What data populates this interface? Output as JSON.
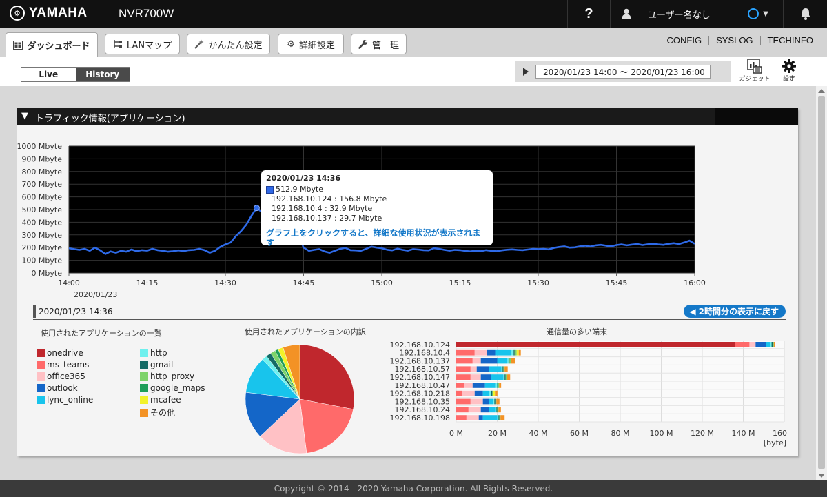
{
  "header": {
    "brand": "YAMAHA",
    "model": "NVR700W",
    "help_label": "?",
    "user_label": "ユーザー名なし"
  },
  "tabs": [
    {
      "label": "ダッシュボード",
      "icon": "dashboard-icon",
      "active": true
    },
    {
      "label": "LANマップ",
      "icon": "lan-map-icon",
      "active": false
    },
    {
      "label": "かんたん設定",
      "icon": "wand-icon",
      "active": false
    },
    {
      "label": "詳細設定",
      "icon": "gear-icon",
      "active": false
    },
    {
      "label": "管　理",
      "icon": "wrench-icon",
      "active": false
    }
  ],
  "top_links": [
    "CONFIG",
    "SYSLOG",
    "TECHINFO"
  ],
  "mode": {
    "live_label": "Live",
    "history_label": "History",
    "selected": "History"
  },
  "range_text": "2020/01/23 14:00 〜 2020/01/23 16:00",
  "tools": {
    "gadget_label": "ガジェット",
    "settings_label": "設定"
  },
  "panel": {
    "title": "トラフィック情報(アプリケーション)"
  },
  "tooltip": {
    "title": "2020/01/23 14:36",
    "total": "512.9 Mbyte",
    "rows": [
      "192.168.10.124 : 156.8 Mbyte",
      "192.168.10.4 : 32.9 Mbyte",
      "192.168.10.137 : 29.7 Mbyte"
    ],
    "hint": "グラフ上をクリックすると、詳細な使用状況が表示されます"
  },
  "detail": {
    "date": "2020/01/23 14:36",
    "back_label": "2時間分の表示に戻す"
  },
  "sections": {
    "apps_title": "使用されたアプリケーションの一覧",
    "pie_title": "使用されたアプリケーションの内訳",
    "hosts_title": "通信量の多い端末"
  },
  "colors": {
    "accent": "#1478c8",
    "line": "#2e6ae8"
  },
  "chart_data": [
    {
      "type": "line",
      "title": "",
      "x_labels": [
        "14:00",
        "14:15",
        "14:30",
        "14:45",
        "15:00",
        "15:15",
        "15:30",
        "15:45",
        "16:00"
      ],
      "x_sublabel": "2020/01/23",
      "y_ticks": [
        "0 Mbyte",
        "100 Mbyte",
        "200 Mbyte",
        "300 Mbyte",
        "400 Mbyte",
        "500 Mbyte",
        "600 Mbyte",
        "700 Mbyte",
        "800 Mbyte",
        "900 Mbyte",
        "1000 Mbyte"
      ],
      "ylim": [
        0,
        1000
      ],
      "x_range_minutes": [
        0,
        120
      ],
      "highlight": {
        "x_minute": 36,
        "y": 512.9
      },
      "series": [
        {
          "color": "#2e6ae8",
          "points": [
            [
              0,
              195
            ],
            [
              1,
              188
            ],
            [
              2,
              182
            ],
            [
              3,
              190
            ],
            [
              4,
              175
            ],
            [
              5,
              200
            ],
            [
              6,
              178
            ],
            [
              7,
              150
            ],
            [
              8,
              170
            ],
            [
              9,
              160
            ],
            [
              10,
              175
            ],
            [
              11,
              168
            ],
            [
              12,
              185
            ],
            [
              13,
              172
            ],
            [
              14,
              180
            ],
            [
              15,
              176
            ],
            [
              16,
              190
            ],
            [
              17,
              180
            ],
            [
              18,
              175
            ],
            [
              19,
              168
            ],
            [
              20,
              172
            ],
            [
              21,
              178
            ],
            [
              22,
              173
            ],
            [
              23,
              180
            ],
            [
              24,
              182
            ],
            [
              25,
              190
            ],
            [
              26,
              180
            ],
            [
              27,
              160
            ],
            [
              28,
              175
            ],
            [
              29,
              205
            ],
            [
              30,
              225
            ],
            [
              31,
              240
            ],
            [
              32,
              290
            ],
            [
              33,
              330
            ],
            [
              34,
              380
            ],
            [
              35,
              450
            ],
            [
              36,
              512.9
            ],
            [
              37,
              480
            ],
            [
              38,
              460
            ],
            [
              39,
              470
            ],
            [
              40,
              440
            ],
            [
              41,
              455
            ],
            [
              42,
              470
            ],
            [
              43,
              430
            ],
            [
              44,
              300
            ],
            [
              45,
              200
            ],
            [
              46,
              175
            ],
            [
              47,
              182
            ],
            [
              48,
              188
            ],
            [
              49,
              170
            ],
            [
              50,
              160
            ],
            [
              51,
              175
            ],
            [
              52,
              190
            ],
            [
              53,
              198
            ],
            [
              54,
              180
            ],
            [
              55,
              178
            ],
            [
              56,
              175
            ],
            [
              57,
              190
            ],
            [
              58,
              208
            ],
            [
              59,
              200
            ],
            [
              60,
              195
            ],
            [
              61,
              183
            ],
            [
              62,
              178
            ],
            [
              63,
              192
            ],
            [
              64,
              182
            ],
            [
              65,
              176
            ],
            [
              66,
              188
            ],
            [
              67,
              185
            ],
            [
              68,
              180
            ],
            [
              69,
              178
            ],
            [
              70,
              195
            ],
            [
              71,
              190
            ],
            [
              72,
              182
            ],
            [
              73,
              176
            ],
            [
              74,
              182
            ],
            [
              75,
              180
            ],
            [
              76,
              174
            ],
            [
              77,
              170
            ],
            [
              78,
              176
            ],
            [
              79,
              172
            ],
            [
              80,
              180
            ],
            [
              81,
              175
            ],
            [
              82,
              172
            ],
            [
              83,
              178
            ],
            [
              84,
              183
            ],
            [
              85,
              186
            ],
            [
              86,
              182
            ],
            [
              87,
              180
            ],
            [
              88,
              185
            ],
            [
              89,
              190
            ],
            [
              90,
              188
            ],
            [
              91,
              190
            ],
            [
              92,
              186
            ],
            [
              93,
              198
            ],
            [
              94,
              205
            ],
            [
              95,
              210
            ],
            [
              96,
              200
            ],
            [
              97,
              202
            ],
            [
              98,
              210
            ],
            [
              99,
              215
            ],
            [
              100,
              208
            ],
            [
              101,
              218
            ],
            [
              102,
              222
            ],
            [
              103,
              215
            ],
            [
              104,
              210
            ],
            [
              105,
              220
            ],
            [
              106,
              225
            ],
            [
              107,
              218
            ],
            [
              108,
              224
            ],
            [
              109,
              228
            ],
            [
              110,
              220
            ],
            [
              111,
              226
            ],
            [
              112,
              230
            ],
            [
              113,
              225
            ],
            [
              114,
              222
            ],
            [
              115,
              230
            ],
            [
              116,
              235
            ],
            [
              117,
              228
            ],
            [
              118,
              240
            ],
            [
              119,
              255
            ],
            [
              120,
              230
            ]
          ]
        }
      ]
    },
    {
      "type": "pie",
      "title": "",
      "slices": [
        {
          "name": "onedrive",
          "value": 28.0,
          "color": "#c0272d"
        },
        {
          "name": "ms_teams",
          "value": 20.0,
          "color": "#ff6a6a"
        },
        {
          "name": "office365",
          "value": 15.0,
          "color": "#ffc1c5"
        },
        {
          "name": "outlook",
          "value": 14.0,
          "color": "#1466c8"
        },
        {
          "name": "lync_online",
          "value": 11.0,
          "color": "#18c4ec"
        },
        {
          "name": "http",
          "value": 1.5,
          "color": "#6ef0ee"
        },
        {
          "name": "gmail",
          "value": 1.5,
          "color": "#156b66"
        },
        {
          "name": "http_proxy",
          "value": 1.5,
          "color": "#7dd36a"
        },
        {
          "name": "google_maps",
          "value": 1.0,
          "color": "#1e9e58"
        },
        {
          "name": "mcafee",
          "value": 1.5,
          "color": "#f2f22a"
        },
        {
          "name": "その他",
          "value": 5.0,
          "color": "#f39225"
        }
      ]
    },
    {
      "type": "bar",
      "orientation": "horizontal",
      "stacked": true,
      "title": "",
      "categories": [
        "192.168.10.124",
        "192.168.10.4",
        "192.168.10.137",
        "192.168.10.57",
        "192.168.10.147",
        "192.168.10.47",
        "192.168.10.218",
        "192.168.10.35",
        "192.168.10.24",
        "192.168.10.198"
      ],
      "x_ticks": [
        "0 M",
        "20 M",
        "40 M",
        "60 M",
        "80 M",
        "100 M",
        "120 M",
        "140 M",
        "160 M"
      ],
      "xlim": [
        0,
        160
      ],
      "x_unit": "[byte]",
      "series_order": [
        "onedrive",
        "ms_teams",
        "office365",
        "outlook",
        "lync_online",
        "http",
        "gmail",
        "http_proxy",
        "google_maps",
        "mcafee",
        "その他"
      ],
      "values": [
        [
          136,
          7,
          3,
          5,
          2,
          0.8,
          0.6,
          0.5,
          0,
          0,
          0.5
        ],
        [
          0,
          9,
          6,
          4,
          8,
          1,
          0.5,
          1,
          0,
          1,
          1
        ],
        [
          0,
          8,
          4,
          8,
          5,
          0.5,
          0.5,
          0.6,
          0,
          0,
          2
        ],
        [
          0,
          7,
          3,
          6,
          6,
          0.6,
          0.4,
          0.6,
          0,
          0,
          1.5
        ],
        [
          0,
          7,
          5,
          5,
          6,
          0.6,
          0.5,
          0.7,
          0,
          0,
          1.5
        ],
        [
          0,
          4,
          4,
          6,
          5,
          1,
          0.5,
          0.4,
          0,
          0,
          1
        ],
        [
          0,
          3,
          6,
          4,
          3,
          1,
          0.6,
          0.5,
          0,
          0.8,
          1.2
        ],
        [
          0,
          7,
          6,
          3,
          2,
          0.6,
          0.5,
          0.5,
          0,
          0,
          1.5
        ],
        [
          0,
          6,
          6,
          4,
          3,
          0.6,
          0.4,
          0.6,
          0,
          0,
          1.2
        ],
        [
          0,
          5,
          6,
          2,
          7,
          0.6,
          0.4,
          0.6,
          0,
          0,
          2
        ]
      ]
    }
  ],
  "footer": "Copyright © 2014 - 2020 Yamaha Corporation. All Rights Reserved."
}
